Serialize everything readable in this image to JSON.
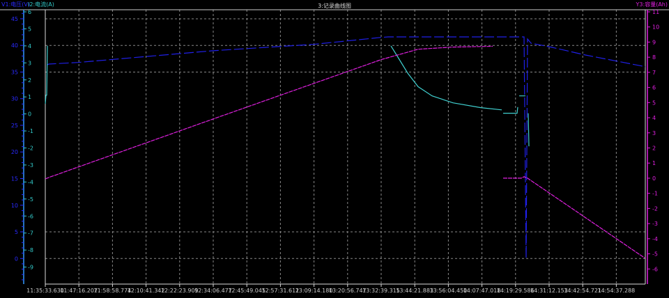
{
  "chart_data": {
    "type": "line",
    "title": "3:记录曲线图",
    "axes": {
      "x": {
        "type": "time",
        "range": [
          "11:35:33.630",
          "15:04:44"
        ],
        "tick_labels": [
          "11:35:33.630",
          "11:47:16.207",
          "11:58:58.774",
          "12:10:41.342",
          "12:22:23.909",
          "12:34:06.477",
          "12:45:49.045",
          "12:57:31.612",
          "13:09:14.180",
          "13:20:56.747",
          "13:32:39.315",
          "13:44:21.883",
          "13:56:04.450",
          "14:07:47.018",
          "14:19:29.586",
          "14:31:12.153",
          "14:42:54.721",
          "14:54:37.288"
        ]
      },
      "y_voltage": {
        "label": "V1:电压(V)",
        "range": [
          -4.8,
          46.3
        ],
        "ticks": [
          0,
          5,
          10,
          15,
          20,
          25,
          30,
          35,
          40,
          45
        ],
        "side": "left-outer",
        "color": "#2a2aff"
      },
      "y_current": {
        "label": "I2:电流(A)",
        "range": [
          -10,
          6
        ],
        "ticks": [
          -9,
          -8,
          -7,
          -6,
          -5,
          -4,
          -3,
          -2,
          -1,
          0,
          1,
          2,
          3,
          4,
          5,
          6
        ],
        "side": "left-inner",
        "color": "#33cccc"
      },
      "y_capacity": {
        "label": "Y3:容量(Ah)",
        "range": [
          -7,
          11
        ],
        "ticks": [
          -6,
          -5,
          -4,
          -3,
          -2,
          -1,
          0,
          1,
          2,
          3,
          4,
          5,
          6,
          7,
          8,
          9,
          10,
          11
        ],
        "side": "right",
        "color": "#e020e0"
      }
    },
    "grid": {
      "vertical": true,
      "horizontal_at_voltage": [
        0,
        5,
        35,
        40,
        45
      ],
      "style": "dashed"
    },
    "series": [
      {
        "axis": "y_voltage",
        "color": "#2020e8",
        "points": [
          [
            "11:36:03",
            36.3
          ],
          [
            "11:36:46",
            36.5
          ],
          [
            "11:46:59",
            36.8
          ],
          [
            "12:33:52",
            39.0
          ],
          [
            "13:09:06",
            40.2
          ],
          [
            "13:32:40",
            41.5
          ],
          [
            "13:35:05",
            41.6
          ],
          [
            "14:22:28",
            41.6
          ],
          [
            "14:23:11",
            0.1
          ],
          [
            "14:23:41",
            41.2
          ],
          [
            "14:24:53",
            40.4
          ],
          [
            "14:31:42",
            39.7
          ],
          [
            "14:43:50",
            38.2
          ],
          [
            "15:04:44",
            36.0
          ]
        ]
      },
      {
        "axis": "y_current",
        "color": "#40d0d0",
        "points": [
          [
            "11:35:34",
            0.6
          ],
          [
            "11:35:48",
            1.1
          ],
          [
            "11:36:03",
            1.1
          ],
          [
            "11:36:17",
            4.0
          ],
          null,
          [
            "13:36:04",
            4.0
          ],
          [
            "13:38:15",
            3.4
          ],
          [
            "13:41:54",
            2.4
          ],
          [
            "13:45:32",
            1.6
          ],
          [
            "13:50:24",
            1.06
          ],
          [
            "13:57:41",
            0.65
          ],
          [
            "14:07:24",
            0.37
          ],
          [
            "14:14:41",
            0.24
          ],
          null,
          [
            "14:15:10",
            0.04
          ],
          [
            "14:20:02",
            0.04
          ],
          [
            "14:20:17",
            0.4
          ],
          null,
          [
            "14:20:46",
            1.06
          ],
          [
            "14:22:57",
            1.06
          ],
          null,
          [
            "14:23:55",
            0.04
          ],
          [
            "14:24:10",
            -1.9
          ]
        ]
      },
      {
        "axis": "y_capacity",
        "color": "#e020e0",
        "points": [
          [
            "11:35:34",
            -0.05
          ],
          [
            "11:36:46",
            0.05
          ],
          [
            "12:33:52",
            3.9
          ],
          [
            "13:32:40",
            7.84
          ],
          [
            "13:45:32",
            8.53
          ],
          [
            "13:57:41",
            8.67
          ],
          [
            "14:11:32",
            8.72
          ],
          null,
          [
            "14:15:10",
            0.0
          ],
          [
            "14:21:29",
            0.0
          ],
          [
            "14:22:28",
            0.1
          ],
          [
            "14:23:41",
            0.0
          ],
          [
            "15:04:44",
            -5.3
          ]
        ]
      }
    ]
  }
}
